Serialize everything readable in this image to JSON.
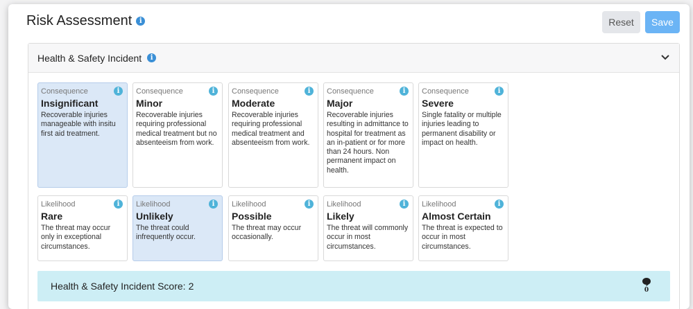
{
  "header": {
    "title": "Risk Assessment",
    "reset_label": "Reset",
    "save_label": "Save"
  },
  "panel": {
    "title": "Health & Safety Incident",
    "consequences": [
      {
        "kind": "Consequence",
        "name": "Insignificant",
        "desc": "Recoverable injuries manageable with insitu first aid treatment.",
        "selected": true
      },
      {
        "kind": "Consequence",
        "name": "Minor",
        "desc": "Recoverable injuries requiring professional medical treatment but no absenteeism from work.",
        "selected": false
      },
      {
        "kind": "Consequence",
        "name": "Moderate",
        "desc": "Recoverable injuries requiring professional medical treatment and absenteeism from work.",
        "selected": false
      },
      {
        "kind": "Consequence",
        "name": "Major",
        "desc": "Recoverable injuries resulting in admittance to hospital for treatment as an in-patient or for more than 24 hours. Non permanent impact on health.",
        "selected": false
      },
      {
        "kind": "Consequence",
        "name": "Severe",
        "desc": "Single fatality or multiple injuries leading to permanent disability or impact on health.",
        "selected": false
      }
    ],
    "likelihoods": [
      {
        "kind": "Likelihood",
        "name": "Rare",
        "desc": "The threat may occur only in exceptional circumstances.",
        "selected": false
      },
      {
        "kind": "Likelihood",
        "name": "Unlikely",
        "desc": "The threat could infrequently occur.",
        "selected": true
      },
      {
        "kind": "Likelihood",
        "name": "Possible",
        "desc": "The threat may occur occasionally.",
        "selected": false
      },
      {
        "kind": "Likelihood",
        "name": "Likely",
        "desc": "The threat will commonly occur in most circumstances.",
        "selected": false
      },
      {
        "kind": "Likelihood",
        "name": "Almost Certain",
        "desc": "The threat is expected to occur in most circumstances.",
        "selected": false
      }
    ],
    "score": {
      "label": "Health & Safety Incident Score:",
      "value": "2",
      "comment_count": "0"
    }
  },
  "colors": {
    "accent": "#6bb4f5",
    "selected_card": "#dbe8f7",
    "score_bar": "#cdeef5",
    "info_icon": "#3a8fd6"
  }
}
